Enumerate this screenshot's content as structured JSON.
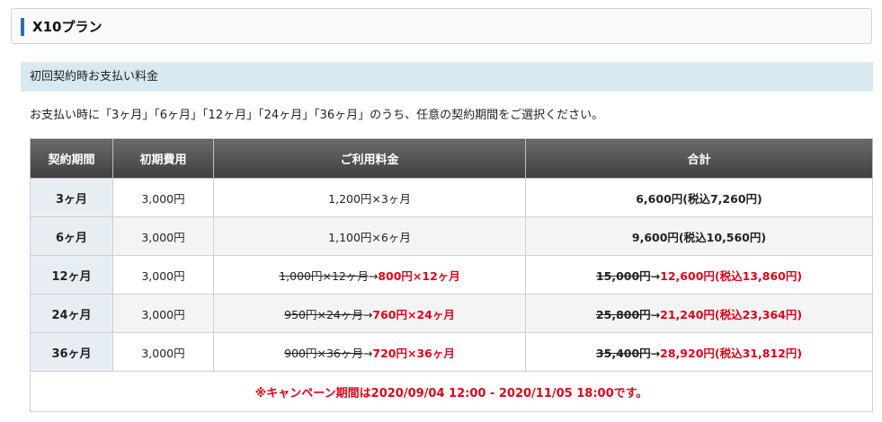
{
  "plan": {
    "title": "X10プラン"
  },
  "section": {
    "title": "初回契約時お支払い料金"
  },
  "intro": "お支払い時に「3ヶ月」「6ヶ月」「12ヶ月」「24ヶ月」「36ヶ月」のうち、任意の契約期間をご選択ください。",
  "table": {
    "headers": [
      "契約期間",
      "初期費用",
      "ご利用料金",
      "合計"
    ],
    "rows": [
      {
        "period": "3ヶ月",
        "fee": "3,000円",
        "usage_old": "",
        "usage_arrow": "",
        "usage_new": "",
        "usage": "1,200円×3ヶ月",
        "total_old": "",
        "total_arrow": "",
        "total_new": "",
        "total": "6,600円(税込7,260円)"
      },
      {
        "period": "6ヶ月",
        "fee": "3,000円",
        "usage_old": "",
        "usage_arrow": "",
        "usage_new": "",
        "usage": "1,100円×6ヶ月",
        "total_old": "",
        "total_arrow": "",
        "total_new": "",
        "total": "9,600円(税込10,560円)"
      },
      {
        "period": "12ヶ月",
        "fee": "3,000円",
        "usage_old": "1,000円×12ヶ月",
        "usage_arrow": "→",
        "usage_new": "800円×12ヶ月",
        "usage": "",
        "total_old": "15,000円",
        "total_arrow": "→",
        "total_new": "12,600円(税込13,860円)",
        "total": ""
      },
      {
        "period": "24ヶ月",
        "fee": "3,000円",
        "usage_old": "950円×24ヶ月",
        "usage_arrow": "→",
        "usage_new": "760円×24ヶ月",
        "usage": "",
        "total_old": "25,800円",
        "total_arrow": "→",
        "total_new": "21,240円(税込23,364円)",
        "total": ""
      },
      {
        "period": "36ヶ月",
        "fee": "3,000円",
        "usage_old": "900円×36ヶ月",
        "usage_arrow": "→",
        "usage_new": "720円×36ヶ月",
        "usage": "",
        "total_old": "35,400円",
        "total_arrow": "→",
        "total_new": "28,920円(税込31,812円)",
        "total": ""
      }
    ],
    "campaign": "※キャンペーン期間は2020/09/04 12:00 - 2020/11/05 18:00です。"
  },
  "colors": {
    "accent_bar": "#2a6fb3",
    "section_bg": "#d8e9f1",
    "campaign_red": "#d9061b"
  }
}
